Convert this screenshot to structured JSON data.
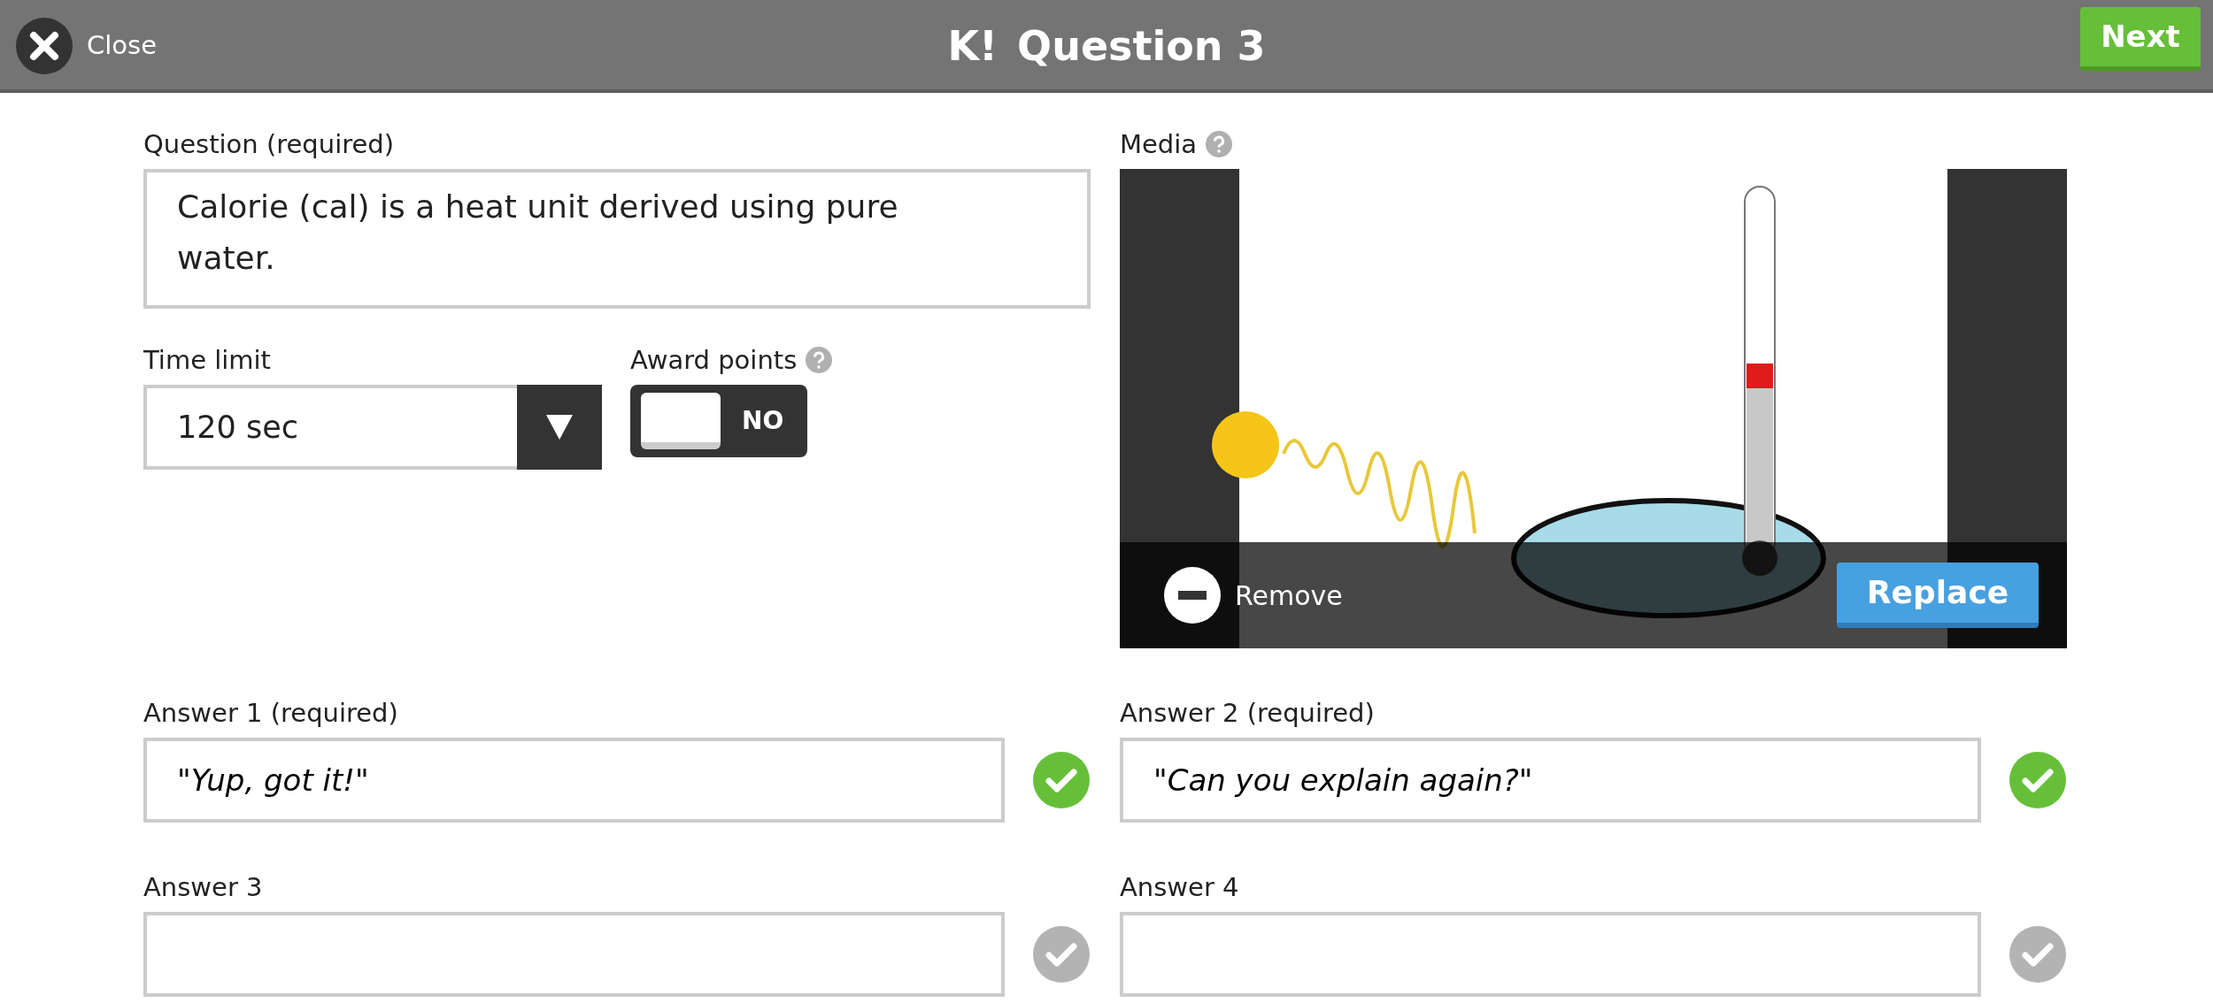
{
  "header": {
    "close_label": "Close",
    "logo": "K!",
    "title": "Question 3",
    "next_label": "Next"
  },
  "question": {
    "label": "Question (required)",
    "value": "Calorie (cal) is a heat unit derived using pure water."
  },
  "time_limit": {
    "label": "Time limit",
    "value": "120 sec"
  },
  "award_points": {
    "label": "Award points",
    "on": false,
    "state_label": "NO"
  },
  "media": {
    "label": "Media",
    "kind": "picture",
    "remove_label": "Remove",
    "replace_label": "Replace"
  },
  "answers": [
    {
      "label": "Answer 1 (required)",
      "value": "\"Yup, got it!\"",
      "correct": true
    },
    {
      "label": "Answer 2 (required)",
      "value": "\"Can you explain again?\"",
      "correct": true
    },
    {
      "label": "Answer 3",
      "correct": false
    },
    {
      "label": "Answer 4",
      "correct": false
    }
  ]
}
